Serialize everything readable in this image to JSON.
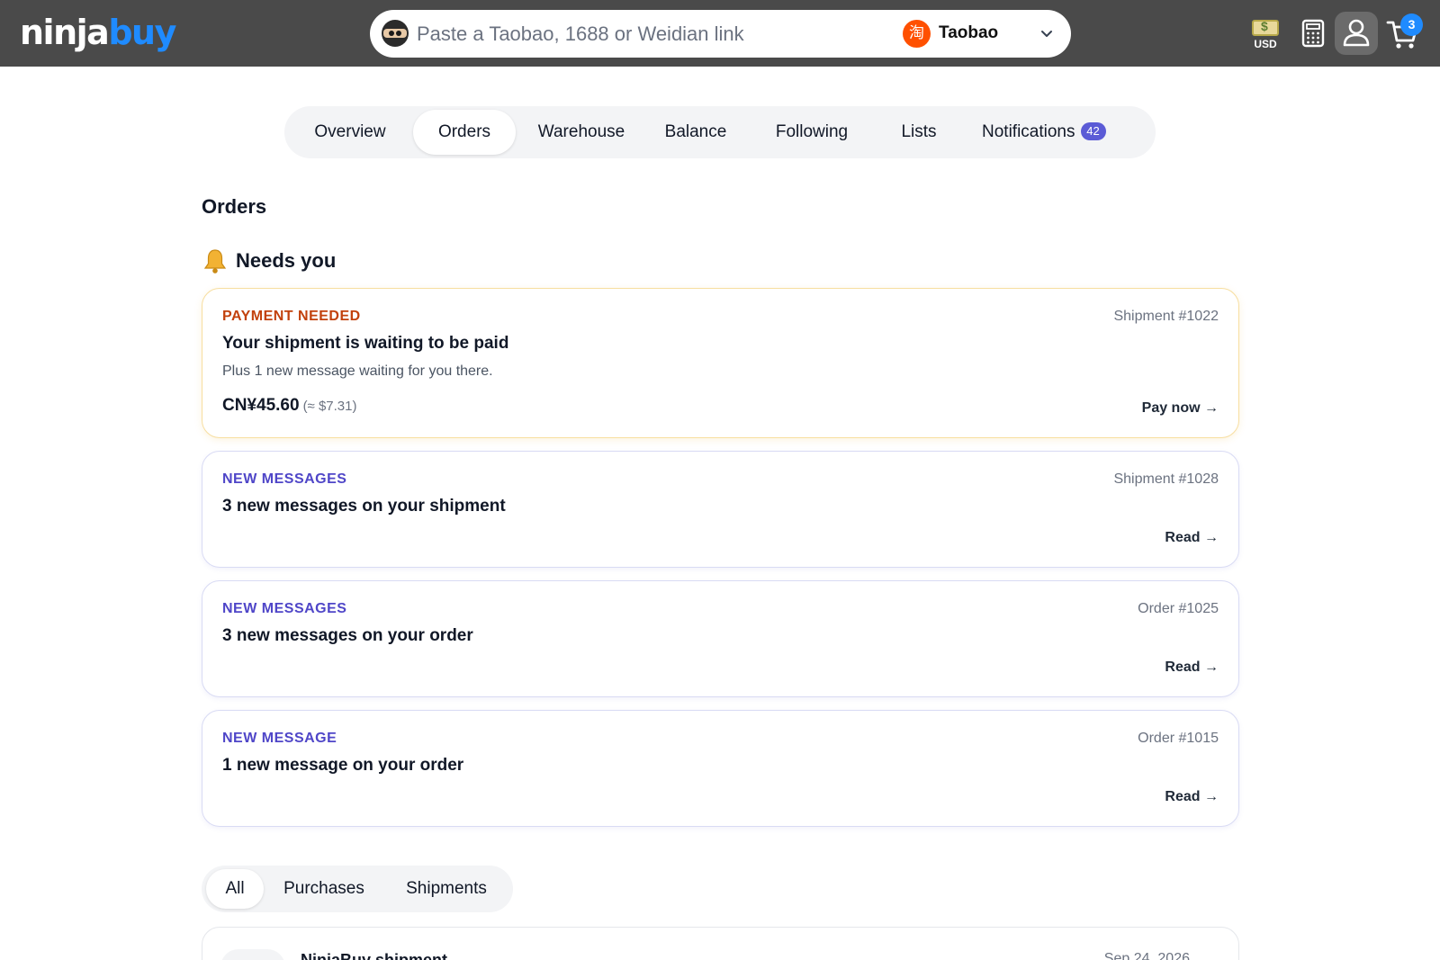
{
  "header": {
    "logo_primary": "ninja",
    "logo_accent": "buy",
    "search_placeholder": "Paste a Taobao, 1688 or Weidian link",
    "platform_label": "Taobao",
    "platform_icon_glyph": "淘",
    "currency_label": "USD",
    "cart_count": "3",
    "accent_color": "#1f8bff"
  },
  "nav": {
    "tabs": [
      {
        "label": "Overview"
      },
      {
        "label": "Orders"
      },
      {
        "label": "Warehouse"
      },
      {
        "label": "Balance"
      },
      {
        "label": "Following"
      },
      {
        "label": "Lists"
      },
      {
        "label": "Notifications"
      }
    ],
    "active": "Orders",
    "notifications_count": "42"
  },
  "page": {
    "title": "Orders",
    "needs_you_title": "Needs you"
  },
  "cards": [
    {
      "kind": "PAYMENT NEEDED",
      "ref": "Shipment #1022",
      "headline": "Your shipment is waiting to be paid",
      "sub": "Plus 1 new message waiting for you there.",
      "price": "CN¥45.60",
      "price_approx": "(≈ $7.31)",
      "action": "Pay now →"
    },
    {
      "kind": "NEW MESSAGES",
      "ref": "Shipment #1028",
      "headline": "3 new messages on your shipment",
      "action": "Read →"
    },
    {
      "kind": "NEW MESSAGES",
      "ref": "Order #1025",
      "headline": "3 new messages on your order",
      "action": "Read →"
    },
    {
      "kind": "NEW MESSAGE",
      "ref": "Order #1015",
      "headline": "1 new message on your order",
      "action": "Read →"
    }
  ],
  "filters": {
    "items": [
      {
        "label": "All"
      },
      {
        "label": "Purchases"
      },
      {
        "label": "Shipments"
      }
    ],
    "active": "All"
  },
  "list": {
    "first_item_title": "NinjaBuy shipment",
    "first_item_date": "Sep 24, 2026"
  }
}
